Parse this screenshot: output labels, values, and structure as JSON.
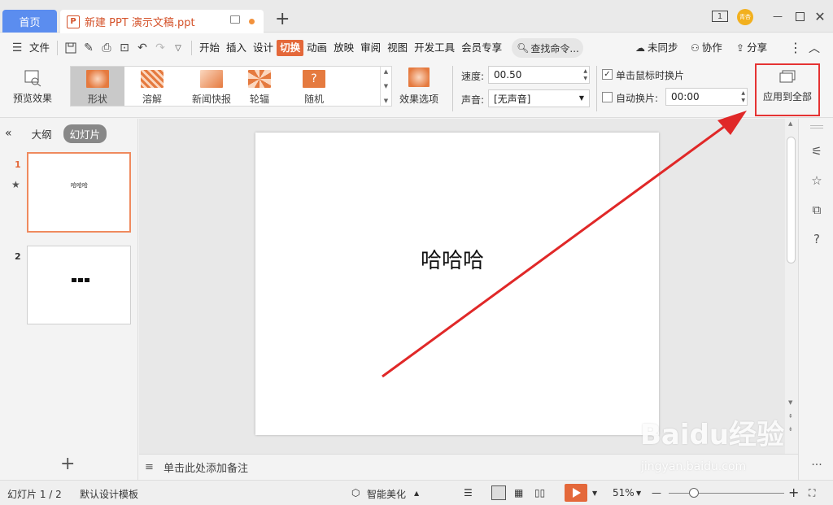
{
  "titlebar": {
    "home_tab": "首页",
    "doc_tab": "新建 PPT 演示文稿.ppt",
    "doc_icon": "P",
    "page_badge": "1",
    "avatar_text": "青杏"
  },
  "menu": {
    "file": "文件",
    "items": [
      "开始",
      "插入",
      "设计",
      "切换",
      "动画",
      "放映",
      "审阅",
      "视图",
      "开发工具",
      "会员专享"
    ],
    "active": "切换",
    "search_placeholder": "查找命令...",
    "sync": "未同步",
    "collab": "协作",
    "share": "分享"
  },
  "ribbon": {
    "preview": "预览效果",
    "transitions": [
      {
        "label": "形状",
        "selected": true
      },
      {
        "label": "溶解",
        "selected": false
      },
      {
        "label": "新闻快报",
        "selected": false
      },
      {
        "label": "轮辐",
        "selected": false
      },
      {
        "label": "随机",
        "selected": false
      }
    ],
    "effect_options": "效果选项",
    "speed_label": "速度:",
    "speed_value": "00.50",
    "sound_label": "声音:",
    "sound_value": "[无声音]",
    "on_click_label": "单击鼠标时换片",
    "on_click_checked": true,
    "auto_label": "自动换片:",
    "auto_value": "00:00",
    "auto_checked": false,
    "apply_all": "应用到全部"
  },
  "left_panel": {
    "tab_outline": "大纲",
    "tab_slides": "幻灯片",
    "slides": [
      {
        "num": "1",
        "text": "哈哈哈"
      },
      {
        "num": "2",
        "text": ""
      }
    ]
  },
  "slide": {
    "text": "哈哈哈"
  },
  "notes": {
    "placeholder": "单击此处添加备注"
  },
  "status": {
    "slide_count": "幻灯片 1 / 2",
    "template": "默认设计模板",
    "beautify": "智能美化",
    "zoom": "51%"
  },
  "watermark": {
    "brand": "Baidu经验",
    "url": "jingyan.baidu.com"
  },
  "colors": {
    "accent": "#e4683a",
    "home_tab": "#5b8def",
    "highlight_box": "#e53333"
  }
}
